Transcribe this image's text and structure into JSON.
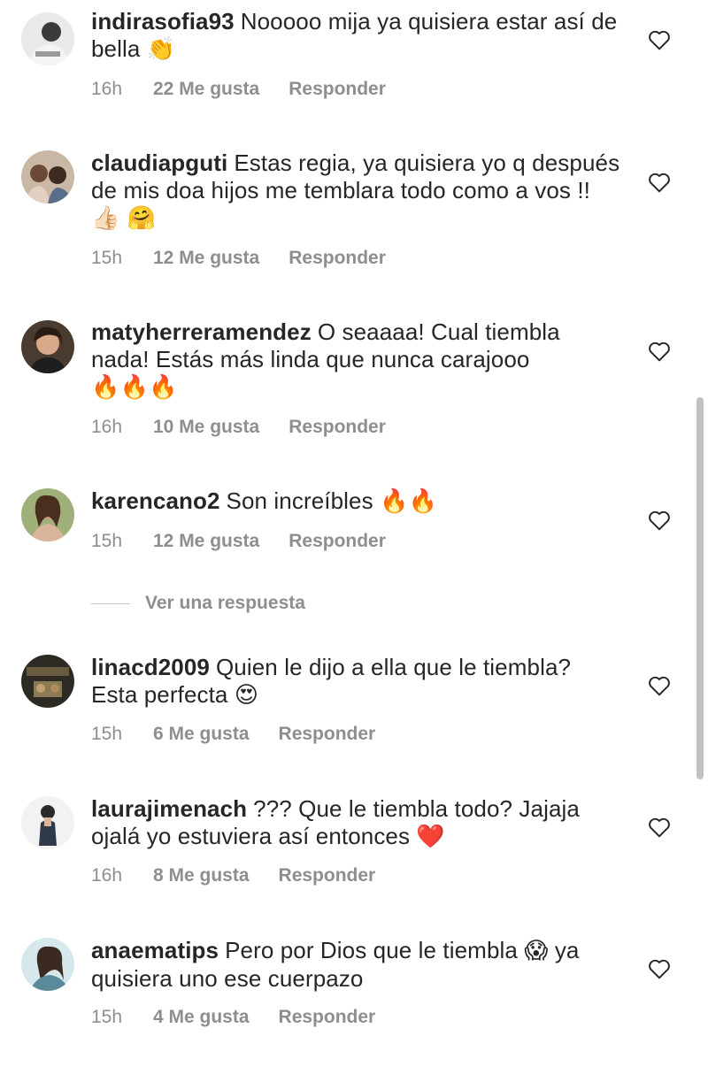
{
  "comments": [
    {
      "username": "indirasofia93",
      "text": "Nooooo mija ya quisiera estar así de bella",
      "emojis": "👏",
      "time": "16h",
      "likes": "22 Me gusta",
      "reply": "Responder"
    },
    {
      "username": "claudiapguti",
      "text": "Estas regia, ya quisiera yo q después de mis doa hijos me temblara todo como a vos !!",
      "emojis": "👍🏻 🤗",
      "time": "15h",
      "likes": "12 Me gusta",
      "reply": "Responder"
    },
    {
      "username": "matyherreramendez",
      "text": "O seaaaa! Cual tiembla nada! Estás más linda que nunca carajooo",
      "emojis": "🔥🔥🔥",
      "time": "16h",
      "likes": "10 Me gusta",
      "reply": "Responder"
    },
    {
      "username": "karencano2",
      "text": "Son increíbles",
      "emojis": "🔥🔥",
      "time": "15h",
      "likes": "12 Me gusta",
      "reply": "Responder"
    },
    {
      "username": "linacd2009",
      "text": "Quien le dijo a ella que le tiembla? Esta perfecta",
      "emojis": "😍",
      "time": "15h",
      "likes": "6 Me gusta",
      "reply": "Responder"
    },
    {
      "username": "laurajimenach",
      "text": "??? Que le tiembla todo? Jajaja ojalá yo estuviera así entonces",
      "emojis": "❤️",
      "time": "16h",
      "likes": "8 Me gusta",
      "reply": "Responder"
    },
    {
      "username": "anaematips",
      "text_before": "Pero por Dios que le tiembla",
      "emojis": "😱",
      "text_after": "ya quisiera uno ese cuerpazo",
      "time": "15h",
      "likes": "4 Me gusta",
      "reply": "Responder"
    }
  ],
  "view_replies": "Ver una respuesta",
  "icons": {
    "like": "heart-outline-icon"
  },
  "colors": {
    "text": "#262626",
    "meta": "#8e8e8e"
  }
}
